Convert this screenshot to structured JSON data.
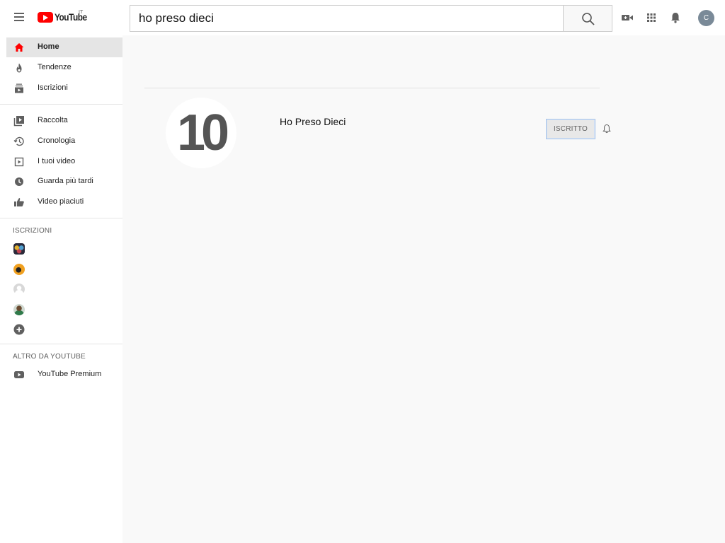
{
  "header": {
    "logo_text": "YouTube",
    "logo_region": "IT",
    "search_value": "ho preso dieci",
    "avatar_letter": "C",
    "icons": [
      "menu-icon",
      "search-icon",
      "video-camera-icon",
      "apps-grid-icon",
      "bell-icon"
    ]
  },
  "sidebar": {
    "primary": [
      {
        "label": "Home",
        "icon": "home-icon",
        "active": true
      },
      {
        "label": "Tendenze",
        "icon": "flame-icon"
      },
      {
        "label": "Iscrizioni",
        "icon": "subscriptions-icon"
      }
    ],
    "library": [
      {
        "label": "Raccolta",
        "icon": "library-icon"
      },
      {
        "label": "Cronologia",
        "icon": "history-icon"
      },
      {
        "label": "I tuoi video",
        "icon": "your-videos-icon"
      },
      {
        "label": "Guarda più tardi",
        "icon": "watch-later-icon"
      },
      {
        "label": "Video piaciuti",
        "icon": "thumbs-up-icon"
      }
    ],
    "subscriptions_title": "ISCRIZIONI",
    "more_title": "ALTRO DA YOUTUBE",
    "more": [
      {
        "label": "YouTube Premium",
        "icon": "youtube-premium-icon"
      }
    ]
  },
  "main": {
    "channel_avatar_text": "10",
    "channel_name": "Ho Preso Dieci",
    "subscribed_label": "ISCRITTO"
  },
  "colors": {
    "brand_red": "#ff0000",
    "active_bg": "#e5e5e5",
    "page_bg": "#f9f9f9"
  }
}
